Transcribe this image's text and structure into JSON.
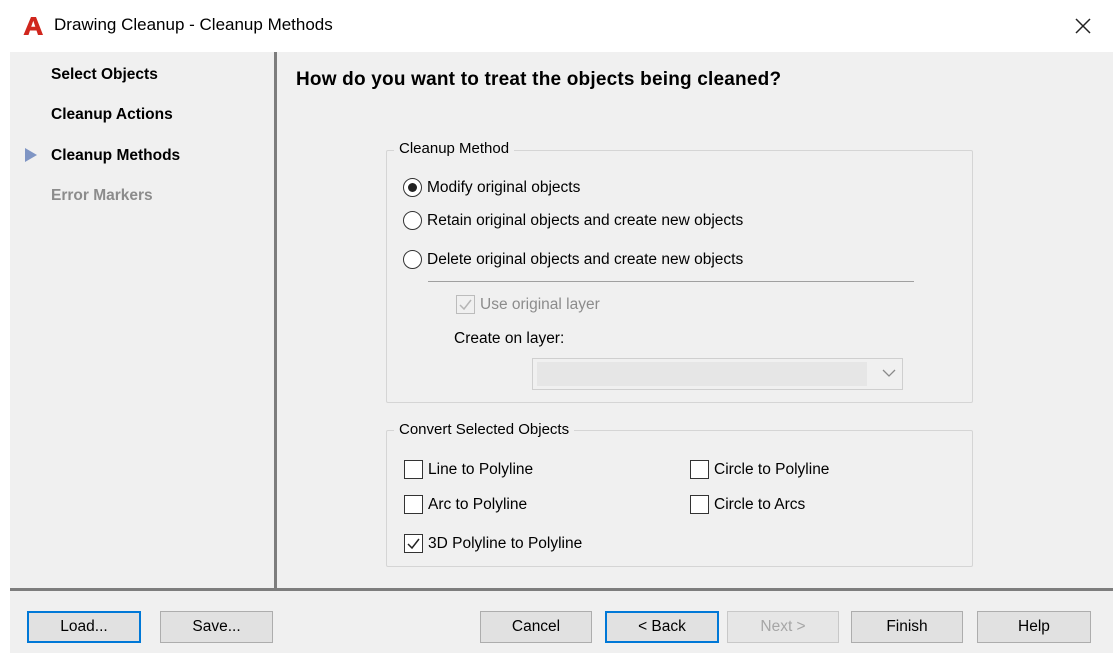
{
  "window": {
    "title": "Drawing Cleanup - Cleanup Methods"
  },
  "nav": {
    "items": [
      {
        "label": "Select Objects",
        "state": "completed"
      },
      {
        "label": "Cleanup Actions",
        "state": "completed"
      },
      {
        "label": "Cleanup Methods",
        "state": "current"
      },
      {
        "label": "Error Markers",
        "state": "disabled"
      }
    ]
  },
  "main": {
    "heading": "How do you want to treat the objects being cleaned?",
    "cleanup_method": {
      "legend": "Cleanup Method",
      "options": [
        {
          "label": "Modify original objects",
          "selected": true
        },
        {
          "label": "Retain original objects and create new objects",
          "selected": false
        },
        {
          "label": "Delete original objects and create new objects",
          "selected": false
        }
      ],
      "use_original_layer": {
        "label": "Use original layer",
        "checked": true,
        "enabled": false
      },
      "create_on_layer_label": "Create on layer:",
      "create_on_layer_value": ""
    },
    "convert": {
      "legend": "Convert Selected Objects",
      "options": [
        {
          "label": "Line to Polyline",
          "checked": false
        },
        {
          "label": "Arc to Polyline",
          "checked": false
        },
        {
          "label": "3D Polyline to Polyline",
          "checked": true
        },
        {
          "label": "Circle to Polyline",
          "checked": false
        },
        {
          "label": "Circle to Arcs",
          "checked": false
        }
      ]
    }
  },
  "footer": {
    "load_label": "Load...",
    "save_label": "Save...",
    "cancel_label": "Cancel",
    "back_label": "< Back",
    "next_label": "Next >",
    "finish_label": "Finish",
    "help_label": "Help"
  },
  "colors": {
    "app_icon": "#d0261d",
    "nav_arrow": "#7f95c4",
    "focus_border": "#0078d7"
  },
  "icons": {
    "app": "autocad-logo-icon",
    "close": "close-icon",
    "nav_current": "current-step-arrow-icon",
    "dropdown": "chevron-down-icon"
  }
}
